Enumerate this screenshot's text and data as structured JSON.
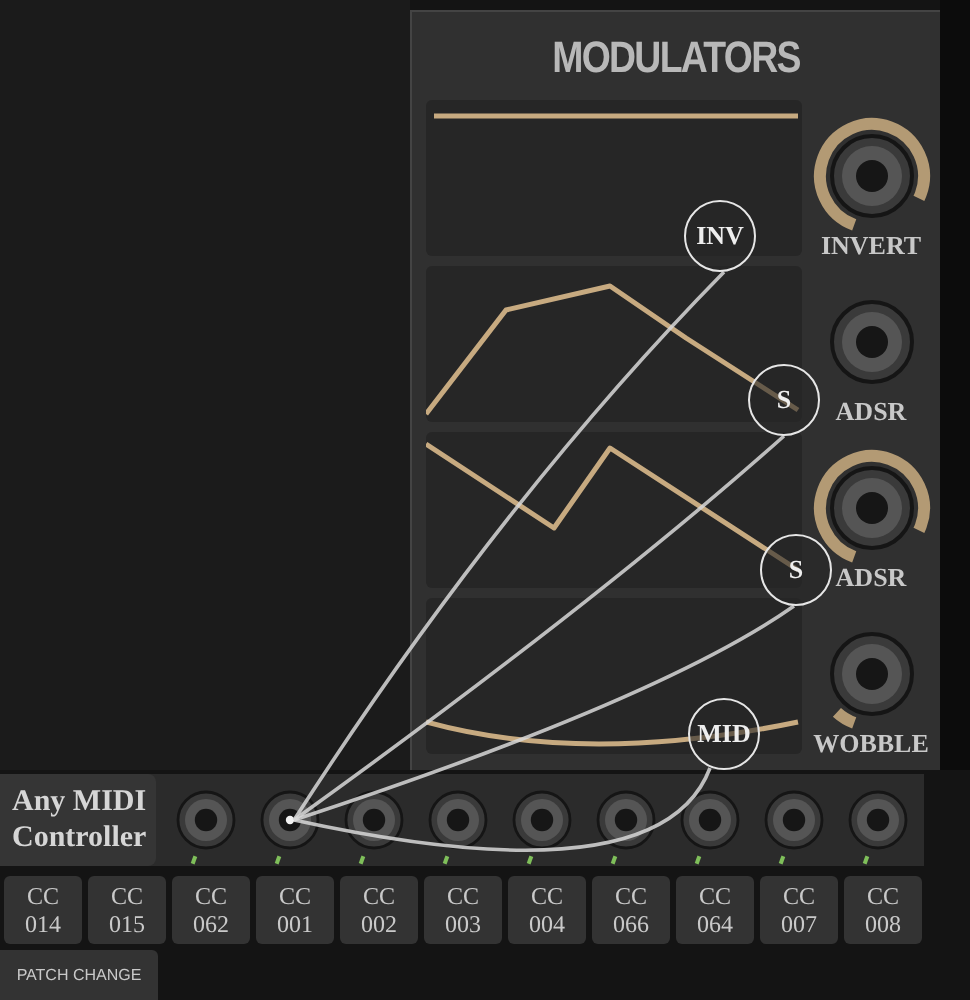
{
  "title": "MODULATORS",
  "modulators": [
    {
      "badge": "INV",
      "label": "INVERT",
      "level": 0.86
    },
    {
      "badge": "S",
      "label": "ADSR"
    },
    {
      "badge": "S",
      "label": "ADSR",
      "level": 0.86
    },
    {
      "badge": "MID",
      "label": "WOBBLE",
      "level": 0.07
    }
  ],
  "midi": {
    "label": "Any MIDI Controller",
    "jacks": [
      {
        "connected": false
      },
      {
        "connected": true
      },
      {
        "connected": false
      },
      {
        "connected": false
      },
      {
        "connected": false
      },
      {
        "connected": false
      },
      {
        "connected": false
      },
      {
        "connected": false
      },
      {
        "connected": false
      }
    ]
  },
  "cc_buttons": [
    "CC 014",
    "CC 015",
    "CC 062",
    "CC 001",
    "CC 002",
    "CC 003",
    "CC 004",
    "CC 066",
    "CC 064",
    "CC 007",
    "CC 008"
  ],
  "patch_change": "PATCH CHANGE"
}
